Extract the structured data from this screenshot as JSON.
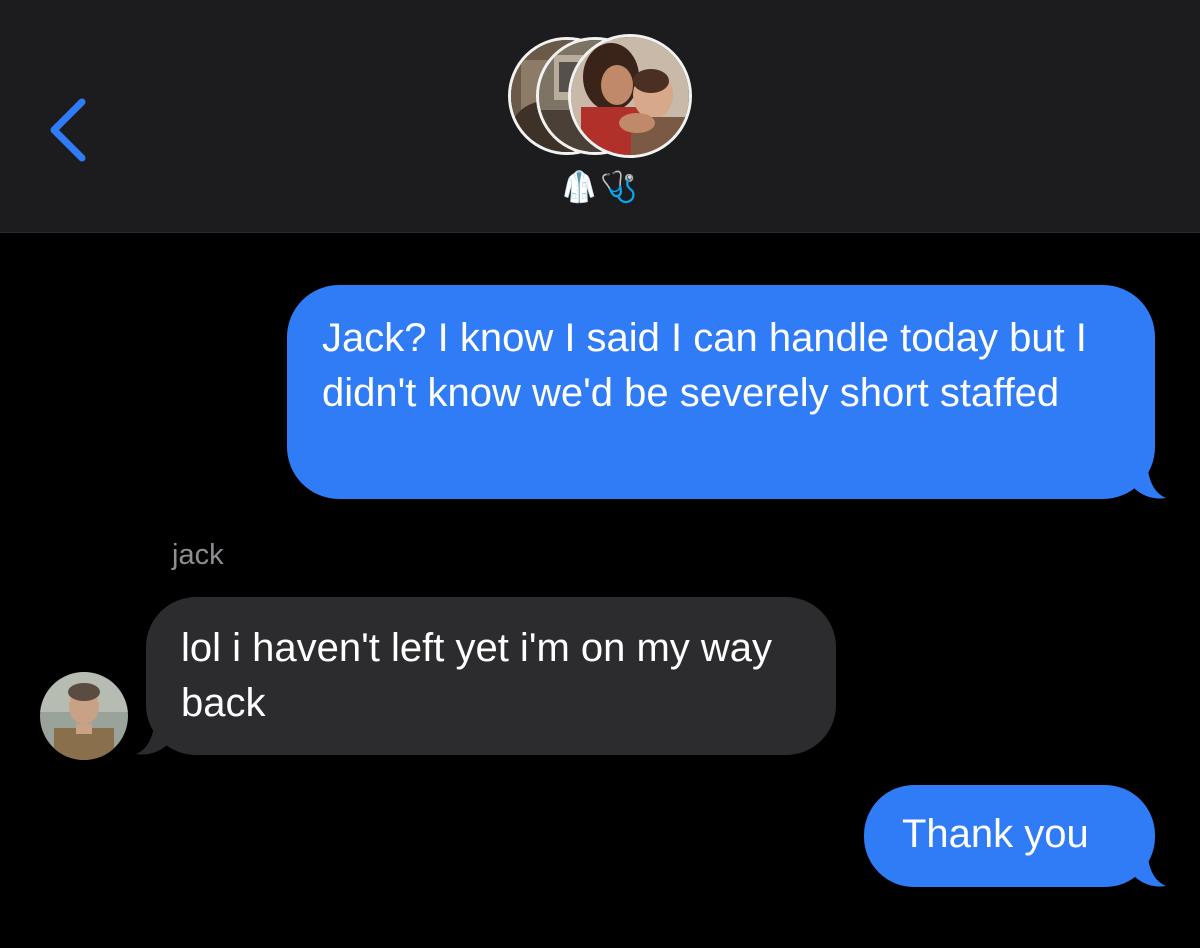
{
  "header": {
    "back_icon": "chevron-left-icon",
    "group_name": "🥼🩺",
    "accent_color": "#2f7cf6"
  },
  "messages": [
    {
      "direction": "sent",
      "text": "Jack? I know I said I can handle today but I didn't know we'd be severely short staffed"
    },
    {
      "direction": "received",
      "sender": "jack",
      "text": "lol i haven't left yet i'm on my way back"
    },
    {
      "direction": "sent",
      "text": "Thank you"
    }
  ],
  "colors": {
    "sent_bubble": "#2f7cf6",
    "received_bubble": "#2c2c2e",
    "header_bg": "#1c1c1e",
    "background": "#000000"
  }
}
